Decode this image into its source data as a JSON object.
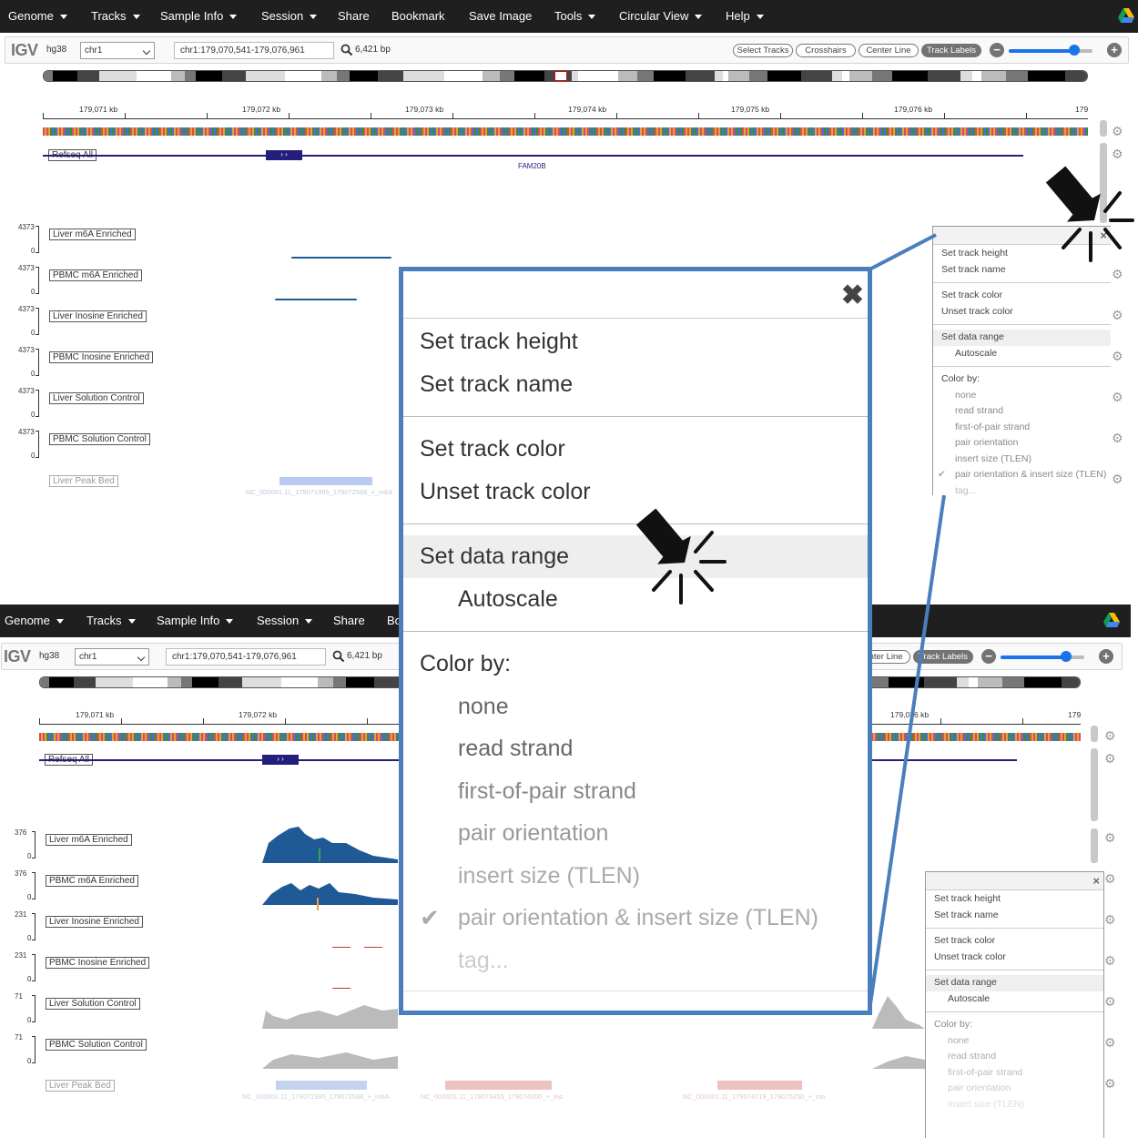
{
  "navbar": {
    "items": [
      "Genome",
      "Tracks",
      "Sample Info",
      "Session",
      "Share",
      "Bookmark",
      "Save Image",
      "Tools",
      "Circular View",
      "Help"
    ],
    "dropdown_flags": [
      true,
      true,
      true,
      true,
      false,
      false,
      false,
      true,
      true,
      true
    ],
    "drive_icon": "google-drive-icon"
  },
  "toolbar": {
    "logo": "IGV",
    "genome": "hg38",
    "chromosome": "chr1",
    "locus": "chr1:179,070,541-179,076,961",
    "bp": "6,421 bp",
    "buttons": [
      "Select Tracks",
      "Crosshairs",
      "Center Line",
      "Track Labels"
    ],
    "active_button": "Track Labels",
    "zoom_level": 0.78
  },
  "ruler": {
    "labels": [
      "179,071 kb",
      "179,072 kb",
      "179,073 kb",
      "179,074 kb",
      "179,075 kb",
      "179,076 kb",
      "179"
    ]
  },
  "gene_track": {
    "label": "Refseq All",
    "gene_name": "FAM20B"
  },
  "top_tracks": [
    {
      "label": "Liver m6A Enriched",
      "max": "4373",
      "min": "0"
    },
    {
      "label": "PBMC m6A Enriched",
      "max": "4373",
      "min": "0"
    },
    {
      "label": "Liver Inosine Enriched",
      "max": "4373",
      "min": "0"
    },
    {
      "label": "PBMC Inosine Enriched",
      "max": "4373",
      "min": "0"
    },
    {
      "label": "Liver Solution Control",
      "max": "4373",
      "min": "0"
    },
    {
      "label": "PBMC Solution Control",
      "max": "4373",
      "min": "0"
    }
  ],
  "bottom_tracks": [
    {
      "label": "Liver m6A Enriched",
      "max": "376",
      "min": "0"
    },
    {
      "label": "PBMC m6A Enriched",
      "max": "376",
      "min": "0"
    },
    {
      "label": "Liver Inosine Enriched",
      "max": "231",
      "min": "0"
    },
    {
      "label": "PBMC Inosine Enriched",
      "max": "231",
      "min": "0"
    },
    {
      "label": "Liver Solution Control",
      "max": "71",
      "min": "0"
    },
    {
      "label": "PBMC Solution Control",
      "max": "71",
      "min": "0"
    }
  ],
  "bed_track": {
    "label": "Liver Peak Bed",
    "feature_label": "NC_000001.11_179071995_179072568_+_m6A",
    "feature_labels_bottom": [
      "NC_000001.11_179071995_179072568_+_m6A",
      "NC_000001.11_179073453_179074200_+_Ino",
      "NC_000001.11_179074719_179075250_+_Ino"
    ]
  },
  "track_menu": {
    "group1": [
      "Set track height",
      "Set track name"
    ],
    "group2": [
      "Set track color",
      "Unset track color"
    ],
    "group3_title": "Set data range",
    "group3_item": "Autoscale",
    "color_by_title": "Color by:",
    "color_by_options": [
      "none",
      "read strand",
      "first-of-pair strand",
      "pair orientation",
      "insert size (TLEN)",
      "pair orientation & insert size (TLEN)",
      "tag..."
    ],
    "checked_option": "pair orientation & insert size (TLEN)"
  },
  "bottom_menu_visible": [
    "none",
    "read strand",
    "first-of-pair strand",
    "pair orientation",
    "insert size (TLEN)"
  ],
  "icons": {
    "close": "close-icon",
    "gear": "gear-icon",
    "search": "search-icon",
    "check": "check-icon",
    "cursor": "mouse-pointer-icon"
  },
  "colors": {
    "navbar": "#1f1f1f",
    "gene": "#231e7c",
    "coverage_enriched": "#1f5a96",
    "coverage_control": "#bbbbbb",
    "zoom_box_border": "#4a7fbc",
    "bed_m6a": "#a9bfe8",
    "bed_ino": "#e6b8b3",
    "slider": "#1a73e8"
  }
}
